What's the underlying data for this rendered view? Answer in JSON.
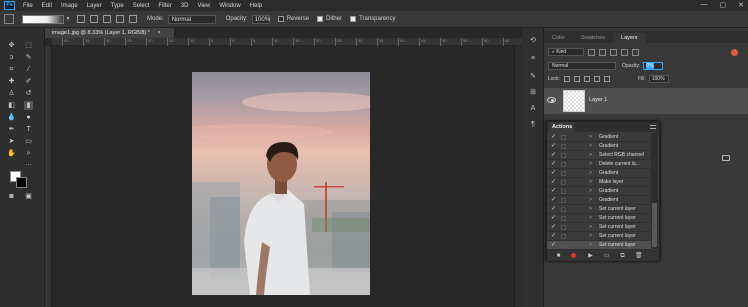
{
  "menubar": {
    "logo": "Ps",
    "items": [
      "File",
      "Edit",
      "Image",
      "Layer",
      "Type",
      "Select",
      "Filter",
      "3D",
      "View",
      "Window",
      "Help"
    ],
    "window_controls": [
      "—",
      "▢",
      "✕"
    ]
  },
  "options": {
    "mode_label": "Mode:",
    "mode_value": "Normal",
    "opacity_label": "Opacity:",
    "opacity_value": "100%",
    "reverse_label": "Reverse",
    "dither_label": "Dither",
    "transparency_label": "Transparency"
  },
  "document": {
    "tab_title": "image1.jpg @ 8.33% (Layer 1, RGB/8) *",
    "tab_close": "×"
  },
  "ruler": {
    "ticks": [
      "40",
      "35",
      "30",
      "25",
      "20",
      "15",
      "10",
      "5",
      "0",
      "5",
      "10",
      "15",
      "20",
      "25",
      "30",
      "35",
      "40",
      "45",
      "50",
      "55",
      "60",
      "65"
    ]
  },
  "panel": {
    "tabs": [
      "Color",
      "Swatches",
      "Layers"
    ],
    "active_tab": "Layers",
    "kind_value": "Kind",
    "blend_value": "Normal",
    "opacity_label": "Opacity:",
    "opacity_value": "0%",
    "lock_label": "Lock:",
    "fill_label": "Fill:",
    "fill_value": "100%",
    "layer_name": "Layer 1"
  },
  "actions": {
    "title": "Actions",
    "rows": [
      {
        "check": "✓",
        "label": "Gradient",
        "selected": false
      },
      {
        "check": "✓",
        "label": "Gradient",
        "selected": false
      },
      {
        "check": "✓",
        "label": "Select RGB channel",
        "selected": false
      },
      {
        "check": "✓",
        "label": "Delete current la...",
        "selected": false
      },
      {
        "check": "✓",
        "label": "Gradient",
        "selected": false
      },
      {
        "check": "✓",
        "label": "Make layer",
        "selected": false
      },
      {
        "check": "✓",
        "label": "Gradient",
        "selected": false
      },
      {
        "check": "✓",
        "label": "Gradient",
        "selected": false
      },
      {
        "check": "✓",
        "label": "Set current layer",
        "selected": false
      },
      {
        "check": "✓",
        "label": "Set current layer",
        "selected": false
      },
      {
        "check": "✓",
        "label": "Set current layer",
        "selected": false
      },
      {
        "check": "✓",
        "label": "Set current layer",
        "selected": false
      },
      {
        "check": "✓",
        "label": "Set current layer",
        "selected": true
      }
    ],
    "footer_buttons": [
      "■",
      "●",
      "▶",
      "▭",
      "⧉",
      "🗑"
    ]
  },
  "colors": {
    "accent": "#31a8ff",
    "foreground": "#ffffff",
    "background": "#000000"
  }
}
